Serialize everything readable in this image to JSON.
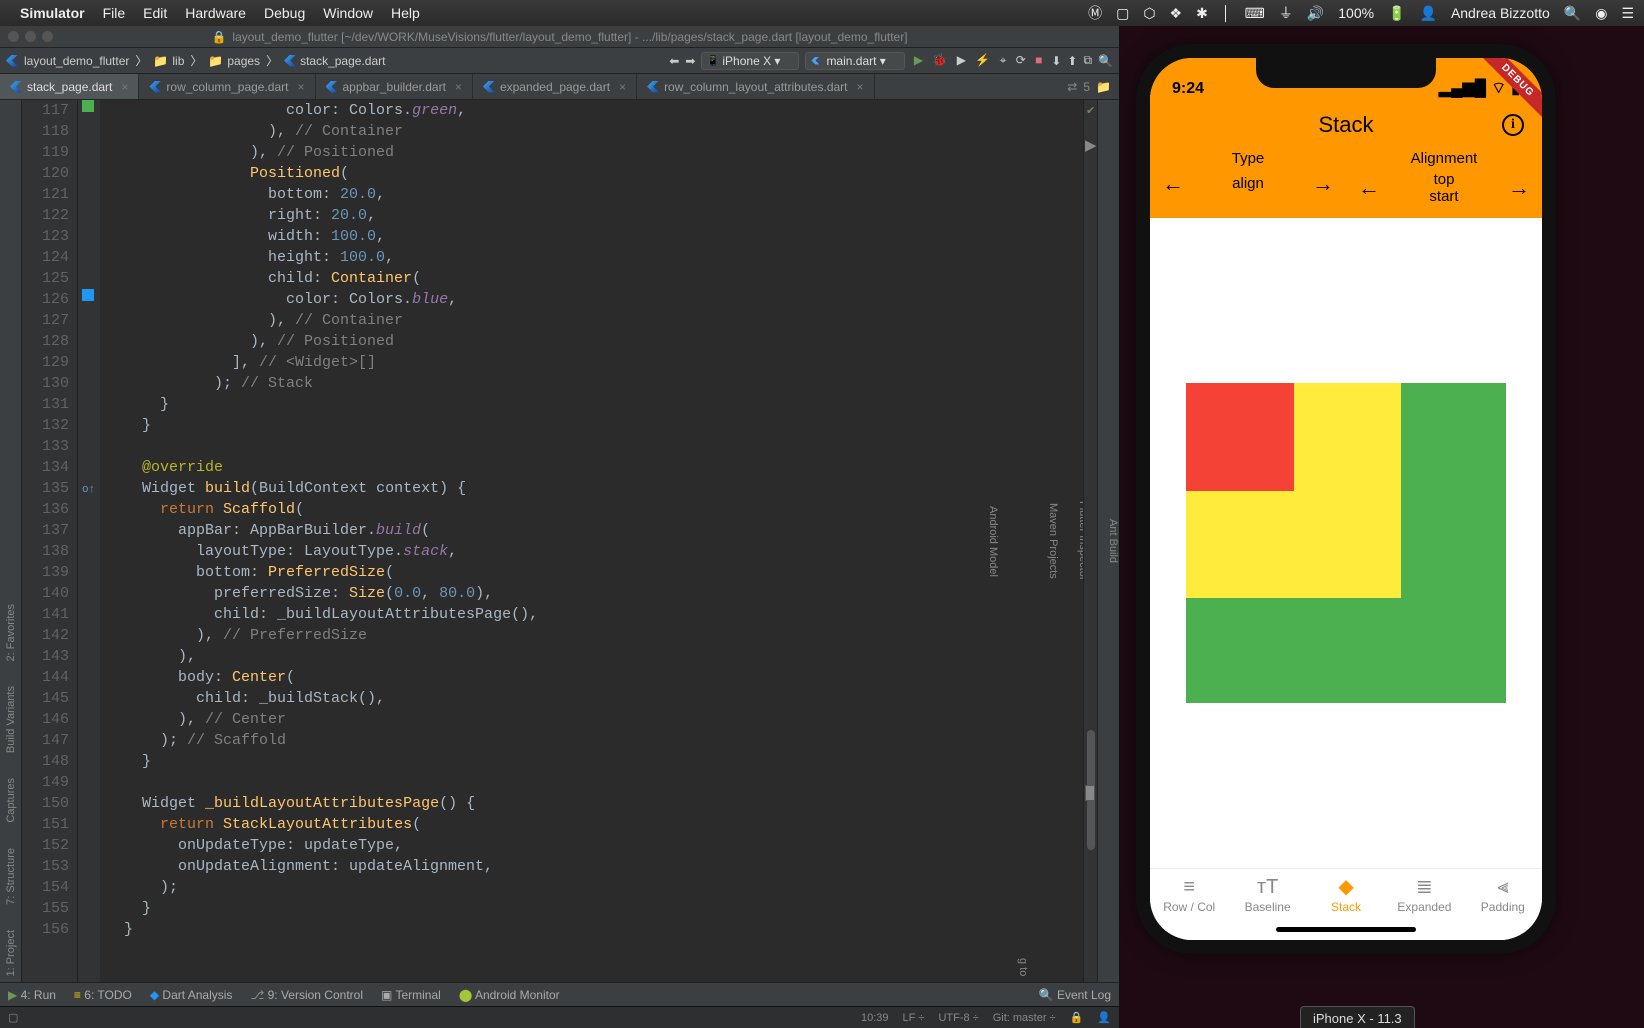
{
  "menubar": {
    "app": "Simulator",
    "items": [
      "File",
      "Edit",
      "Hardware",
      "Debug",
      "Window",
      "Help"
    ],
    "battery": "100%",
    "charge_icon": "⚡",
    "user": "Andrea Bizzotto"
  },
  "ide": {
    "title": "layout_demo_flutter [~/dev/WORK/MuseVisions/flutter/layout_demo_flutter] - .../lib/pages/stack_page.dart [layout_demo_flutter]",
    "project_name": "layout_demo_flutter",
    "breadcrumb": [
      "lib",
      "pages",
      "stack_page.dart"
    ],
    "device": "iPhone X ▾",
    "config": "main.dart ▾",
    "tabs": [
      {
        "name": "stack_page.dart",
        "active": true
      },
      {
        "name": "row_column_page.dart",
        "active": false
      },
      {
        "name": "appbar_builder.dart",
        "active": false
      },
      {
        "name": "expanded_page.dart",
        "active": false
      },
      {
        "name": "row_column_layout_attributes.dart",
        "active": false
      }
    ],
    "arrow_count": "5",
    "left_tools": [
      "2: Favorites",
      "Build Variants",
      "Captures",
      "7: Structure",
      "1: Project"
    ],
    "right_tools": [
      "Ant Build",
      "Flutter Inspector",
      "Maven Projects",
      "Android Model"
    ],
    "right_cut": "g to",
    "bottom_tools": {
      "run": "4: Run",
      "todo": "6: TODO",
      "dart": "Dart Analysis",
      "vcs": "9: Version Control",
      "terminal": "Terminal",
      "monitor": "Android Monitor",
      "eventlog": "Event Log"
    },
    "status": {
      "pos": "10:39",
      "lf": "LF ÷",
      "enc": "UTF-8 ÷",
      "git": "Git: master ÷"
    },
    "line_start": 117
  },
  "simulator_label": "iPhone X - 11.3",
  "phone": {
    "time": "9:24",
    "title": "Stack",
    "debug": "DEBUG",
    "type_label": "Type",
    "align_label": "Alignment",
    "type_value": "align",
    "align_value": "top\nstart",
    "nav": [
      {
        "label": "Row / Col",
        "icon": "≡"
      },
      {
        "label": "Baseline",
        "icon": "ᴛT"
      },
      {
        "label": "Stack",
        "icon": "◆"
      },
      {
        "label": "Expanded",
        "icon": "≣"
      },
      {
        "label": "Padding",
        "icon": "⫷"
      }
    ],
    "active_nav": 2
  }
}
